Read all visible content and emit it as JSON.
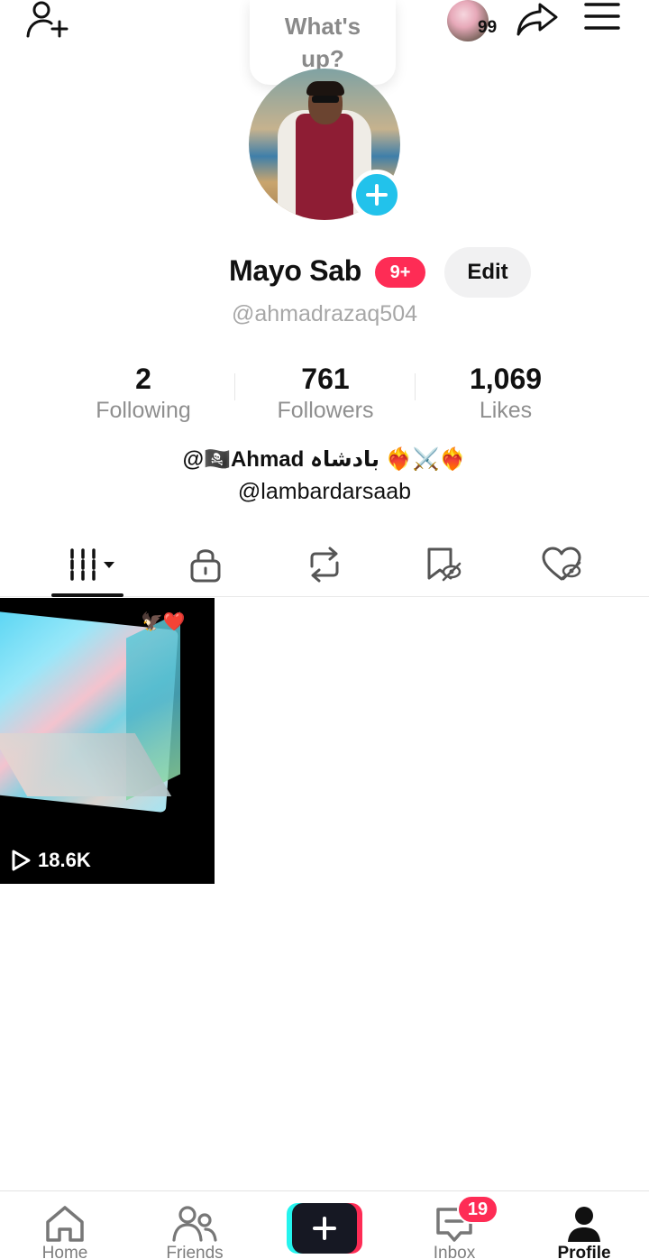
{
  "header": {
    "add_friend_icon": "person-add-icon",
    "story_count": "99",
    "share_icon": "share-arrow-icon",
    "menu_icon": "hamburger-menu-icon"
  },
  "note_bubble": {
    "text": "What's up?"
  },
  "profile": {
    "name": "Mayo Sab",
    "notification_badge": "9+",
    "edit_label": "Edit",
    "handle": "@ahmadrazaq504"
  },
  "stats": [
    {
      "value": "2",
      "label": "Following"
    },
    {
      "value": "761",
      "label": "Followers"
    },
    {
      "value": "1,069",
      "label": "Likes"
    }
  ],
  "bio": {
    "line1": "@🏴‍☠️Ahmad بادشاہ ❤️‍🔥⚔️❤️‍🔥",
    "line2": "@lambardarsaab"
  },
  "tabs": [
    {
      "icon": "grid-videos-icon"
    },
    {
      "icon": "lock-icon"
    },
    {
      "icon": "repost-icon"
    },
    {
      "icon": "bookmark-hidden-icon"
    },
    {
      "icon": "liked-hidden-icon"
    }
  ],
  "videos": [
    {
      "views": "18.6K",
      "overlay_emoji": "🦅❤️"
    }
  ],
  "bottom_nav": {
    "home": "Home",
    "friends": "Friends",
    "inbox": "Inbox",
    "inbox_badge": "19",
    "profile": "Profile"
  },
  "colors": {
    "accent_red": "#fe2c55",
    "accent_cyan": "#25f4ee",
    "add_button_blue": "#22c2eb"
  }
}
